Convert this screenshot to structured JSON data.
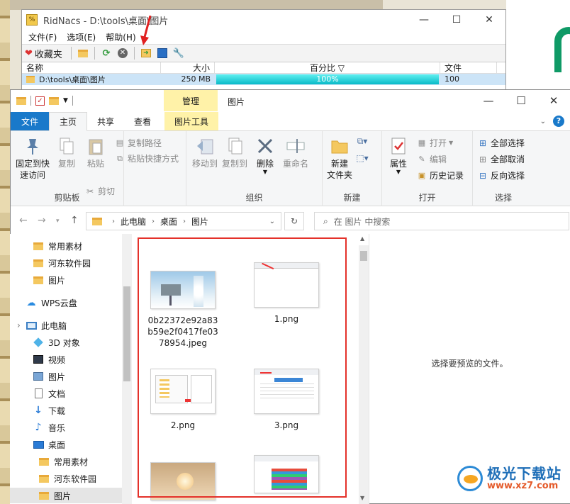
{
  "ridnacs": {
    "title": "RidNacs - D:\\tools\\桌面\\图片",
    "menu": [
      "文件(F)",
      "选项(E)",
      "帮助(H)"
    ],
    "favorites_label": "收藏夹",
    "columns": [
      "名称",
      "大小",
      "百分比 ▽",
      "文件"
    ],
    "row": {
      "name": "D:\\tools\\桌面\\图片",
      "size": "250 MB",
      "percent": "100%",
      "files": "100"
    },
    "app_icon": "%"
  },
  "explorer": {
    "ctx_tab": "管理",
    "title": "图片",
    "tabs": [
      "文件",
      "主页",
      "共享",
      "查看",
      "图片工具"
    ],
    "ribbon": {
      "pin": "固定到快\n速访问",
      "copy": "复制",
      "paste": "粘贴",
      "copy_path": "复制路径",
      "paste_shortcut": "粘贴快捷方式",
      "cut": "剪切",
      "clipboard": "剪贴板",
      "move_to": "移动到",
      "copy_to": "复制到",
      "delete": "删除",
      "rename": "重命名",
      "organize": "组织",
      "new_folder": "新建\n文件夹",
      "new": "新建",
      "properties": "属性",
      "open": "打开",
      "edit": "编辑",
      "history": "历史记录",
      "open_group": "打开",
      "select_all": "全部选择",
      "select_none": "全部取消",
      "invert": "反向选择",
      "select_group": "选择"
    },
    "address": {
      "crumbs": [
        "此电脑",
        "桌面",
        "图片"
      ],
      "search_placeholder": "在 图片 中搜索"
    },
    "nav": [
      {
        "label": "常用素材",
        "icon": "folder-icon"
      },
      {
        "label": "河东软件园",
        "icon": "folder-icon"
      },
      {
        "label": "图片",
        "icon": "folder-icon"
      },
      {
        "label": "WPS云盘",
        "icon": "cloud-icon"
      },
      {
        "label": "此电脑",
        "icon": "computer-icon"
      },
      {
        "label": "3D 对象",
        "icon": "cube-icon"
      },
      {
        "label": "视频",
        "icon": "video-icon"
      },
      {
        "label": "图片",
        "icon": "picture-icon"
      },
      {
        "label": "文档",
        "icon": "document-icon"
      },
      {
        "label": "下载",
        "icon": "download-icon"
      },
      {
        "label": "音乐",
        "icon": "music-icon"
      },
      {
        "label": "桌面",
        "icon": "desktop-icon"
      },
      {
        "label": "常用素材",
        "icon": "folder-icon"
      },
      {
        "label": "河东软件园",
        "icon": "folder-icon"
      },
      {
        "label": "图片",
        "icon": "folder-icon"
      }
    ],
    "files": [
      {
        "name": "0b22372e92a83b59e2f0417fe0378954.jpeg"
      },
      {
        "name": "1.png"
      },
      {
        "name": "2.png"
      },
      {
        "name": "3.png"
      },
      {
        "name": ""
      },
      {
        "name": ""
      }
    ],
    "preview_text": "选择要预览的文件。"
  },
  "watermark": {
    "title": "极光下载站",
    "url": "www.xz7.com"
  },
  "colors": {
    "accent": "#1979ca",
    "context_tab": "#fff2a8",
    "selection_border": "#e4312a",
    "progress": "#08b9c7"
  }
}
